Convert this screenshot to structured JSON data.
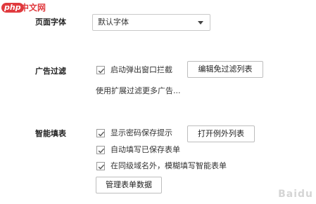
{
  "watermark": {
    "logo_php": "php",
    "logo_cn": "中文网",
    "corner_text": "Baidu"
  },
  "page_font": {
    "label": "页面字体",
    "selected": "默认字体"
  },
  "ad_filter": {
    "label": "广告过滤",
    "popup_block_label": "启动弹出窗口拦截",
    "popup_block_checked": true,
    "edit_button": "编辑免过滤列表",
    "more_link": "使用扩展过滤更多广告..."
  },
  "smart_fill": {
    "label": "智能填表",
    "show_prompt_label": "显示密码保存提示",
    "show_prompt_checked": true,
    "open_exceptions_button": "打开例外列表",
    "auto_fill_label": "自动填写已保存表单",
    "auto_fill_checked": true,
    "fuzzy_fill_label": "在同级域名外，模糊填写智能表单",
    "fuzzy_fill_checked": true,
    "manage_button": "管理表单数据"
  },
  "colors": {
    "accent_red": "#e03a3e",
    "border": "#bdbdbd",
    "text": "#333333"
  }
}
